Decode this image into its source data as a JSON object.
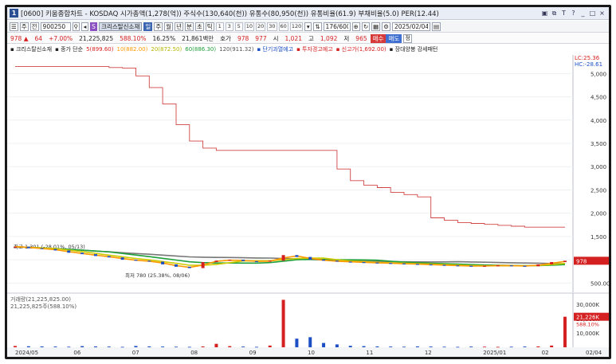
{
  "window": {
    "title": "[0600] 키움종합차트 - KOSDAQ 시가총액(1,278(억)) 주식수(130,640(천)) 유통수(80,950(천)) 유통비율(61.9) 부채비율(5.0) PER(12.44)",
    "icon_label": "1"
  },
  "toolbar": {
    "menu_label": "주",
    "mode_label": "전",
    "code_value": "900250",
    "stock_name": "크리스탈신소재",
    "timeframes": [
      "일",
      "주",
      "월",
      "년",
      "분",
      "초",
      "틱"
    ],
    "intervals": [
      "1",
      "3",
      "5",
      "10",
      "20",
      "30",
      "60",
      "120"
    ],
    "count_value": "176/600",
    "date_value": "2025/02/04"
  },
  "quote": {
    "price": "978",
    "change": "64",
    "change_pct": "+7.00%",
    "volume": "21,225,825",
    "volume_pct": "588.10%",
    "turnover": "16.25%",
    "amount": "21,861백만",
    "bid_label": "호가",
    "bid": "978",
    "ask": "977",
    "open_label": "시",
    "open": "1,021",
    "high_label": "고",
    "high": "1,092",
    "low_label": "저",
    "low": "965",
    "buy_label": "매수",
    "sell_label": "매도",
    "extra_label": "정"
  },
  "legend": {
    "stock": "크리스탈신소재",
    "ma_header": "종가 단순",
    "ma5": "5(899.60)",
    "ma10": "10(882.00)",
    "ma20": "20(872.50)",
    "ma60": "60(886.30)",
    "ma120": "120(911.32)",
    "warn1": "단기과열예고",
    "warn2": "투자경고예고",
    "warn3": "신고가(1,692.00)",
    "pattern": "장대양봉 강세패턴"
  },
  "chart_data": {
    "type": "line",
    "price_axis_ticks": [
      "5,000",
      "4,500",
      "4,000",
      "3,500",
      "3,000",
      "2,500",
      "2,000",
      "1,500",
      "1,000",
      "500.00"
    ],
    "price_axis_top": "LC:25.36",
    "price_axis_top2": "HC:-28.61",
    "current_price_label": "978",
    "x_ticks": [
      "2024/05",
      "06",
      "07",
      "08",
      "09",
      "10",
      "11",
      "12",
      "2025/01",
      "02",
      "02/04"
    ],
    "high_annotation": "최고 1,301 (-28.01%, 05/13)",
    "low_annotation": "최저 780 (25.38%, 08/06)",
    "limit_line": [
      5150,
      5150,
      5150,
      5150,
      5150,
      5150,
      5150,
      5130,
      5120,
      4950,
      4700,
      4350,
      3900,
      3550,
      3400,
      3350,
      3350,
      3350,
      3350,
      3350,
      3350,
      3350,
      3350,
      3350,
      2950,
      2700,
      2600,
      2550,
      2450,
      2400,
      2350,
      1900,
      1850,
      1800,
      1780,
      1760,
      1740,
      1720,
      1700,
      1700,
      1700,
      1700
    ],
    "price_series": [
      1280,
      1250,
      1230,
      1200,
      1150,
      1120,
      1080,
      1050,
      1000,
      980,
      960,
      900,
      850,
      820,
      950,
      980,
      1000,
      970,
      960,
      980,
      1100,
      1060,
      1000,
      980,
      960,
      950,
      940,
      930,
      920,
      910,
      900,
      890,
      880,
      870,
      860,
      870,
      880,
      870,
      860,
      900,
      950,
      978
    ],
    "volume_axis_ticks": [
      "30,000K",
      "20,000K",
      "10,000K"
    ],
    "volume_label": "거래량(21,225,825.00)",
    "volume_sublabel": "21,225,825주(588.10%)",
    "volume_current_label": "21,226K",
    "volume_current_pct": "588.10%",
    "volume_series": [
      900,
      700,
      600,
      500,
      400,
      800,
      600,
      500,
      300,
      900,
      600,
      500,
      400,
      300,
      600,
      2400,
      800,
      500,
      300,
      1200,
      33000,
      6000,
      7000,
      3000,
      2000,
      1000,
      800,
      600,
      500,
      400,
      600,
      500,
      400,
      300,
      500,
      400,
      300,
      400,
      500,
      600,
      1200,
      21226
    ]
  },
  "colors": {
    "accent": "#2b4f93",
    "up": "#d42020",
    "down": "#1d4fc4",
    "ma5": "#d81f1f",
    "ma10": "#ff9900",
    "ma20": "#cccc00",
    "ma60": "#1f9f3a",
    "ma120": "#777777"
  }
}
